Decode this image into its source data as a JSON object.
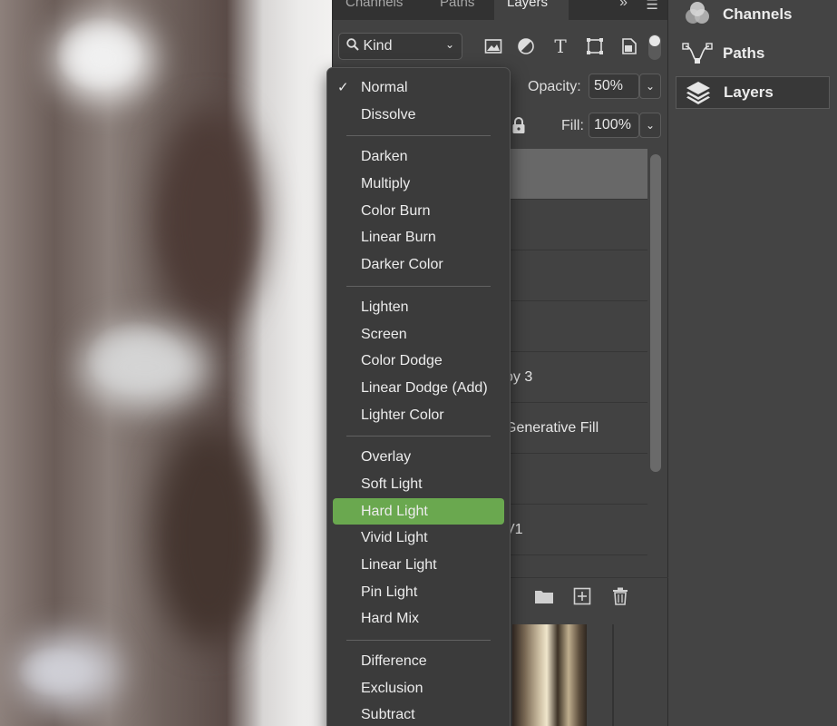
{
  "tabs": [
    "Channels",
    "Paths",
    "Layers"
  ],
  "active_tab": "Layers",
  "filter": {
    "kind_label": "Kind"
  },
  "opacity": {
    "label": "Opacity:",
    "value": "50%"
  },
  "fill": {
    "label": "Fill:",
    "value": "100%"
  },
  "layers_visible_text": [
    "py 3",
    "Generative Fill",
    "V1"
  ],
  "dock": {
    "items": [
      {
        "label": "Channels",
        "icon": "channels-icon"
      },
      {
        "label": "Paths",
        "icon": "paths-icon"
      },
      {
        "label": "Layers",
        "icon": "layers-icon"
      }
    ],
    "selected": "Layers"
  },
  "blend_menu": {
    "current": "Normal",
    "highlighted": "Hard Light",
    "groups": [
      [
        "Normal",
        "Dissolve"
      ],
      [
        "Darken",
        "Multiply",
        "Color Burn",
        "Linear Burn",
        "Darker Color"
      ],
      [
        "Lighten",
        "Screen",
        "Color Dodge",
        "Linear Dodge (Add)",
        "Lighter Color"
      ],
      [
        "Overlay",
        "Soft Light",
        "Hard Light",
        "Vivid Light",
        "Linear Light",
        "Pin Light",
        "Hard Mix"
      ],
      [
        "Difference",
        "Exclusion",
        "Subtract"
      ]
    ]
  },
  "colors": {
    "highlight": "#6aa84f",
    "panel": "#424242",
    "menu": "#3b3b3b"
  }
}
